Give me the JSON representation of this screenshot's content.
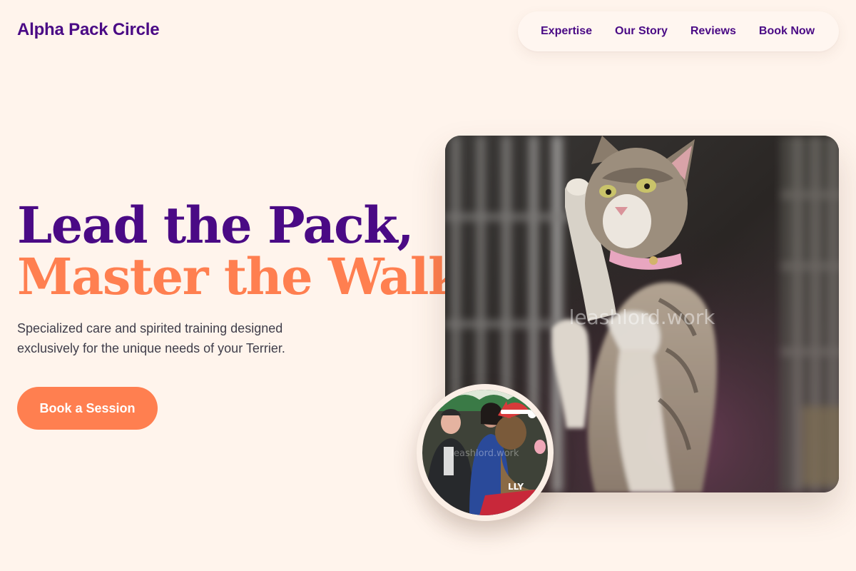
{
  "brand": "Alpha Pack Circle",
  "nav": {
    "items": [
      "Expertise",
      "Our Story",
      "Reviews",
      "Book Now"
    ]
  },
  "hero": {
    "headline_line1": "Lead the Pack,",
    "headline_line2": "Master the Walk.",
    "subtitle": "Specialized care and spirited training designed exclusively for the unique needs of your Terrier.",
    "cta_label": "Book a Session"
  },
  "images": {
    "main_watermark": "leashlord.work",
    "inset_watermark": "leashlord.work"
  },
  "colors": {
    "background": "#fff4ec",
    "brand_purple": "#4a0a85",
    "accent_coral": "#ff7f50",
    "body_text": "#3f3d4a"
  }
}
